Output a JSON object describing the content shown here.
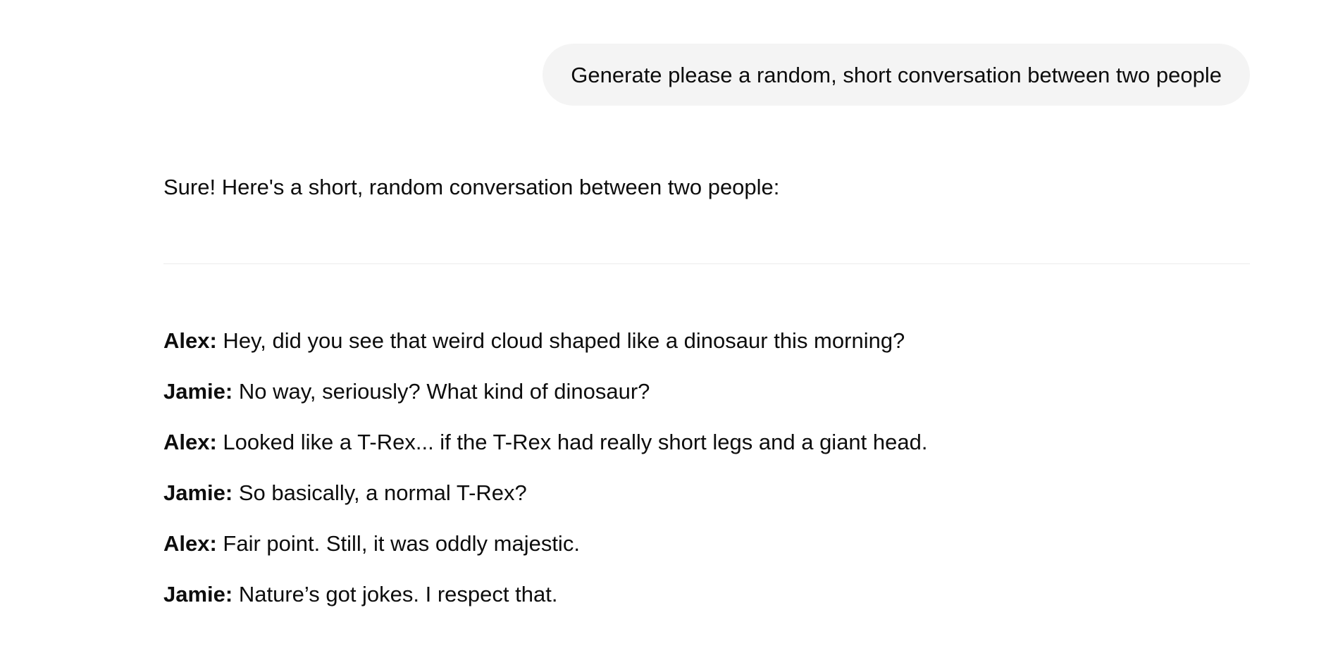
{
  "user_message": {
    "text": "Generate please a random, short conversation between two people"
  },
  "assistant_message": {
    "intro": "Sure! Here's a short, random conversation between two people:",
    "dialogue": [
      {
        "speaker": "Alex:",
        "text": " Hey, did you see that weird cloud shaped like a dinosaur this morning?"
      },
      {
        "speaker": "Jamie:",
        "text": " No way, seriously? What kind of dinosaur?"
      },
      {
        "speaker": "Alex:",
        "text": " Looked like a T-Rex... if the T-Rex had really short legs and a giant head."
      },
      {
        "speaker": "Jamie:",
        "text": " So basically, a normal T-Rex?"
      },
      {
        "speaker": "Alex:",
        "text": " Fair point. Still, it was oddly majestic."
      },
      {
        "speaker": "Jamie:",
        "text": " Nature’s got jokes. I respect that."
      }
    ]
  },
  "colors": {
    "bubble_background": "#f4f4f4",
    "text": "#0d0d0d",
    "divider": "#ececec",
    "page_background": "#ffffff"
  }
}
